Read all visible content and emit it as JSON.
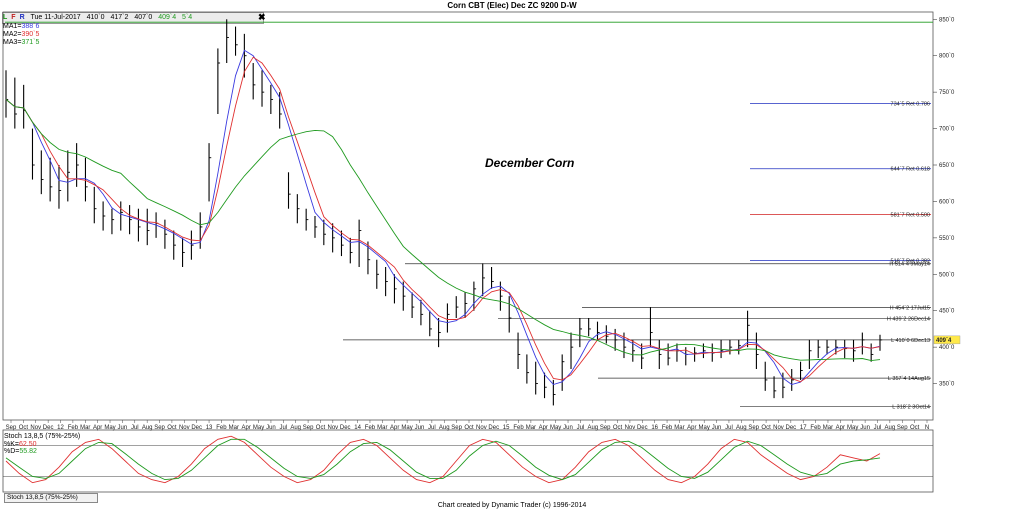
{
  "chart_data": {
    "type": "bar",
    "title": "Corn CBT (Elec) Dec ZC 9200 D-W",
    "infobar": {
      "icons": [
        "L",
        "F",
        "R"
      ],
      "date": "Tue 11-Jul-2017",
      "open": "410`0",
      "high": "417`2",
      "low": "407`0",
      "close": "409`4",
      "change": "5`4"
    },
    "moving_averages": [
      {
        "name": "MA1",
        "value": "388`6",
        "color": "#3a3ae0"
      },
      {
        "name": "MA2",
        "value": "390`5",
        "color": "#e03030"
      },
      {
        "name": "MA3",
        "value": "371`5",
        "color": "#1f9a1f"
      }
    ],
    "annotation": "December Corn",
    "ylim": [
      300,
      860
    ],
    "y_ticks": [
      {
        "value": 850,
        "label": "850`0"
      },
      {
        "value": 800,
        "label": "800`0"
      },
      {
        "value": 750,
        "label": "750`0"
      },
      {
        "value": 700,
        "label": "700`0"
      },
      {
        "value": 650,
        "label": "650`0"
      },
      {
        "value": 600,
        "label": "600`0"
      },
      {
        "value": 550,
        "label": "550`0"
      },
      {
        "value": 500,
        "label": "500`0"
      },
      {
        "value": 450,
        "label": "450`0"
      },
      {
        "value": 400,
        "label": "400`0"
      },
      {
        "value": 350,
        "label": "350`0"
      }
    ],
    "last_price_label": "409`4",
    "x_labels": [
      "Sep",
      "Oct",
      "Nov",
      "Dec",
      "12",
      "Feb",
      "Mar",
      "Apr",
      "May",
      "Jun",
      "Jul",
      "Aug",
      "Sep",
      "Oct",
      "Nov",
      "Dec",
      "13",
      "Feb",
      "Mar",
      "Apr",
      "May",
      "Jun",
      "Jul",
      "Aug",
      "Sep",
      "Oct",
      "Nov",
      "Dec",
      "14",
      "Feb",
      "Mar",
      "Apr",
      "May",
      "Jun",
      "Jul",
      "Aug",
      "Sep",
      "Oct",
      "Nov",
      "Dec",
      "15",
      "Feb",
      "Mar",
      "Apr",
      "May",
      "Jun",
      "Jul",
      "Aug",
      "Sep",
      "Oct",
      "Nov",
      "Dec",
      "16",
      "Feb",
      "Mar",
      "Apr",
      "May",
      "Jun",
      "Jul",
      "Aug",
      "Sep",
      "Oct",
      "Nov",
      "Dec",
      "17",
      "Feb",
      "Mar",
      "Apr",
      "May",
      "Jun",
      "Jul",
      "Aug",
      "Sep",
      "Oct",
      "N"
    ],
    "retracements": [
      {
        "value": 734.6,
        "label": "734`5 Ret 0.786",
        "color": "#2030c0"
      },
      {
        "value": 644.9,
        "label": "644`7 Ret 0.618",
        "color": "#2030c0"
      },
      {
        "value": 581.9,
        "label": "581`7 Ret 0.500",
        "color": "#d02020"
      },
      {
        "value": 518.9,
        "label": "518`7 Ret 0.382",
        "color": "#2030c0"
      }
    ],
    "levels": [
      {
        "value": 514.5,
        "label": "H 514`4 9May14"
      },
      {
        "value": 454.25,
        "label": "H 454`2 17Jul15"
      },
      {
        "value": 439.25,
        "label": "H 439`2 26Dec14"
      },
      {
        "value": 410.0,
        "label": "L 410`0 6Dec13"
      },
      {
        "value": 357.5,
        "label": "L 357`4 14Aug15"
      },
      {
        "value": 318.25,
        "label": "L 318`2 3Oct14"
      }
    ],
    "top_line": {
      "value": 846
    },
    "price_bars": [
      [
        0,
        715,
        780,
        740
      ],
      [
        1,
        700,
        770,
        720
      ],
      [
        2,
        700,
        760,
        725
      ],
      [
        3,
        630,
        700,
        650
      ],
      [
        4,
        610,
        670,
        630
      ],
      [
        5,
        600,
        660,
        620
      ],
      [
        6,
        590,
        650,
        615
      ],
      [
        7,
        600,
        670,
        640
      ],
      [
        8,
        620,
        680,
        650
      ],
      [
        9,
        600,
        660,
        620
      ],
      [
        10,
        570,
        620,
        590
      ],
      [
        11,
        560,
        600,
        580
      ],
      [
        12,
        555,
        590,
        575
      ],
      [
        13,
        560,
        600,
        585
      ],
      [
        14,
        555,
        595,
        575
      ],
      [
        15,
        545,
        590,
        565
      ],
      [
        16,
        540,
        590,
        560
      ],
      [
        17,
        550,
        585,
        570
      ],
      [
        18,
        535,
        575,
        555
      ],
      [
        19,
        520,
        560,
        540
      ],
      [
        20,
        510,
        550,
        530
      ],
      [
        21,
        520,
        560,
        540
      ],
      [
        22,
        535,
        585,
        565
      ],
      [
        23,
        600,
        680,
        660
      ],
      [
        24,
        720,
        810,
        790
      ],
      [
        25,
        790,
        850,
        825
      ],
      [
        26,
        800,
        840,
        815
      ],
      [
        27,
        770,
        830,
        800
      ],
      [
        28,
        740,
        790,
        760
      ],
      [
        29,
        730,
        780,
        750
      ],
      [
        30,
        720,
        760,
        740
      ],
      [
        31,
        700,
        750,
        720
      ],
      [
        32,
        590,
        640,
        610
      ],
      [
        33,
        570,
        610,
        590
      ],
      [
        34,
        560,
        590,
        575
      ],
      [
        35,
        550,
        580,
        565
      ],
      [
        36,
        540,
        575,
        555
      ],
      [
        37,
        530,
        570,
        550
      ],
      [
        38,
        525,
        560,
        540
      ],
      [
        39,
        515,
        550,
        530
      ],
      [
        40,
        510,
        575,
        560
      ],
      [
        41,
        500,
        545,
        520
      ],
      [
        42,
        480,
        520,
        500
      ],
      [
        43,
        470,
        510,
        490
      ],
      [
        44,
        460,
        500,
        480
      ],
      [
        45,
        450,
        490,
        470
      ],
      [
        46,
        440,
        475,
        455
      ],
      [
        47,
        430,
        465,
        445
      ],
      [
        48,
        415,
        450,
        425
      ],
      [
        49,
        400,
        440,
        420
      ],
      [
        50,
        420,
        460,
        445
      ],
      [
        51,
        440,
        470,
        455
      ],
      [
        52,
        440,
        475,
        460
      ],
      [
        53,
        450,
        490,
        480
      ],
      [
        54,
        470,
        515,
        495
      ],
      [
        55,
        480,
        510,
        490
      ],
      [
        56,
        450,
        490,
        470
      ],
      [
        57,
        420,
        470,
        440
      ],
      [
        58,
        370,
        420,
        390
      ],
      [
        59,
        350,
        390,
        365
      ],
      [
        60,
        335,
        380,
        350
      ],
      [
        61,
        330,
        365,
        345
      ],
      [
        62,
        320,
        355,
        335
      ],
      [
        63,
        340,
        390,
        380
      ],
      [
        64,
        370,
        420,
        400
      ],
      [
        65,
        400,
        440,
        425
      ],
      [
        66,
        415,
        440,
        425
      ],
      [
        67,
        410,
        435,
        420
      ],
      [
        68,
        405,
        430,
        415
      ],
      [
        69,
        395,
        425,
        410
      ],
      [
        70,
        385,
        420,
        400
      ],
      [
        71,
        380,
        410,
        395
      ],
      [
        72,
        370,
        405,
        385
      ],
      [
        73,
        400,
        455,
        420
      ],
      [
        74,
        370,
        410,
        390
      ],
      [
        75,
        375,
        405,
        385
      ],
      [
        76,
        380,
        405,
        395
      ],
      [
        77,
        375,
        400,
        390
      ],
      [
        78,
        380,
        400,
        392
      ],
      [
        79,
        385,
        405,
        395
      ],
      [
        80,
        380,
        405,
        392
      ],
      [
        81,
        385,
        410,
        395
      ],
      [
        82,
        390,
        410,
        400
      ],
      [
        83,
        390,
        410,
        402
      ],
      [
        84,
        400,
        450,
        430
      ],
      [
        85,
        370,
        420,
        390
      ],
      [
        86,
        340,
        380,
        355
      ],
      [
        87,
        330,
        360,
        340
      ],
      [
        88,
        330,
        365,
        345
      ],
      [
        89,
        340,
        370,
        355
      ],
      [
        90,
        355,
        380,
        368
      ],
      [
        91,
        370,
        410,
        395
      ],
      [
        92,
        385,
        410,
        400
      ],
      [
        93,
        390,
        410,
        400
      ],
      [
        94,
        390,
        410,
        400
      ],
      [
        95,
        385,
        410,
        398
      ],
      [
        96,
        380,
        410,
        395
      ],
      [
        97,
        390,
        420,
        410
      ],
      [
        98,
        380,
        405,
        390
      ],
      [
        99,
        395,
        417,
        410
      ]
    ],
    "stochastic": {
      "label": "Stoch 13,8,5 (75%-25%)",
      "k_label": "%K",
      "k_value": "62.50",
      "k_color": "#e03030",
      "d_label": "%D",
      "d_value": "55.82",
      "d_color": "#1f9a1f",
      "bands": [
        75,
        25
      ],
      "k": [
        50,
        30,
        15,
        20,
        40,
        65,
        80,
        85,
        70,
        50,
        30,
        20,
        15,
        25,
        45,
        70,
        85,
        90,
        80,
        60,
        40,
        25,
        15,
        20,
        35,
        60,
        80,
        85,
        75,
        55,
        35,
        20,
        15,
        25,
        50,
        75,
        85,
        80,
        60,
        40,
        25,
        15,
        20,
        40,
        65,
        80,
        85,
        75,
        55,
        35,
        20,
        15,
        25,
        45,
        70,
        85,
        80,
        60,
        45,
        30,
        20,
        25,
        40,
        60,
        55,
        50,
        62
      ],
      "d": [
        55,
        40,
        25,
        22,
        30,
        50,
        70,
        80,
        78,
        62,
        45,
        30,
        20,
        22,
        35,
        55,
        75,
        85,
        85,
        72,
        55,
        38,
        25,
        22,
        28,
        45,
        65,
        78,
        80,
        68,
        50,
        32,
        22,
        22,
        35,
        58,
        75,
        82,
        75,
        58,
        40,
        27,
        20,
        28,
        48,
        68,
        80,
        82,
        72,
        55,
        38,
        25,
        22,
        32,
        52,
        72,
        82,
        75,
        60,
        45,
        32,
        26,
        30,
        45,
        50,
        52,
        55
      ]
    }
  },
  "footer": "Chart created by Dynamic Trader  (c) 1996-2014",
  "stoch_tab": "Stoch 13,8,5 (75%-25%)"
}
